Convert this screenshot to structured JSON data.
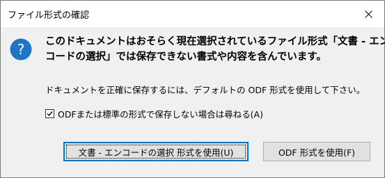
{
  "window": {
    "title": "ファイル形式の確認"
  },
  "message": {
    "line1": "このドキュメントはおそらく現在選択されているファイル形式「文書 - エン",
    "line2": "コードの選択」では保存できない書式や内容を含んでいます。",
    "detail": "ドキュメントを正確に保存するには、デフォルトの ODF 形式を使用して下さい。"
  },
  "option": {
    "label": "ODFまたは標準の形式で保存しない場合は尋ねる(A)",
    "checked": true
  },
  "buttons": {
    "keep_format": "文書 - エンコードの選択 形式を使用(U)",
    "use_odf": "ODF 形式を使用(F)"
  },
  "icons": {
    "dialog": "question-icon",
    "close": "close-icon",
    "check": "checkmark-icon"
  },
  "colors": {
    "question_icon": "#1e74c6",
    "focus_border": "#0078d7",
    "dialog_background": "#f0f0f0"
  }
}
